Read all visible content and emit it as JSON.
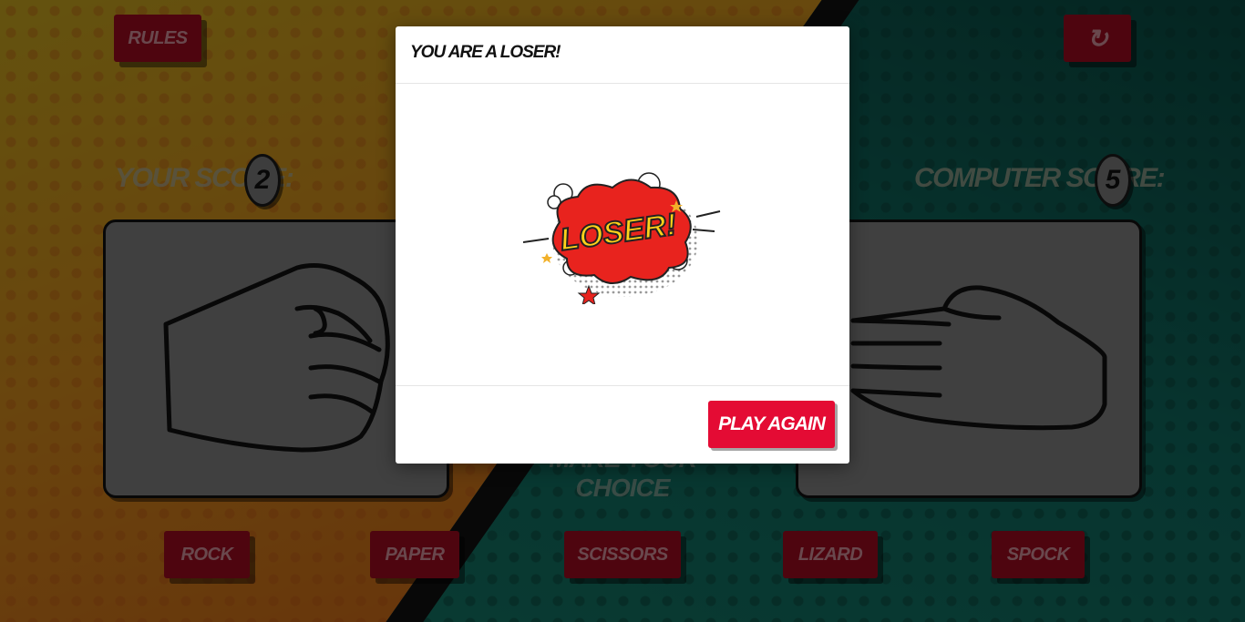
{
  "app": {
    "rules_label": "Rules",
    "reset_icon": "refresh-icon"
  },
  "scores": {
    "player_label": "Your Score:",
    "player_value": "2",
    "computer_label": "Computer Score:",
    "computer_value": "5"
  },
  "player_hand": "rock",
  "computer_hand": "paper",
  "prompt": "Make your choice",
  "choices": [
    "Rock",
    "Paper",
    "Scissors",
    "Lizard",
    "Spock"
  ],
  "modal": {
    "title": "You are a loser!",
    "image_text": "LOSER!",
    "play_again_label": "Play Again"
  },
  "colors": {
    "button": "#9c0a1f",
    "play_again": "#e40b34",
    "left_bg": "#d3891c",
    "right_bg": "#0f6a5f"
  }
}
